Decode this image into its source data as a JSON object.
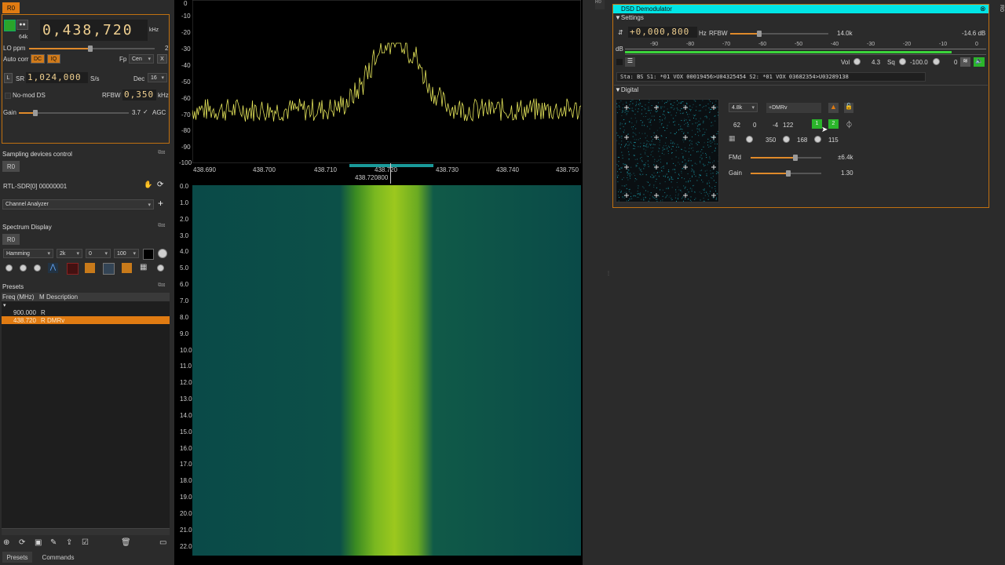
{
  "left": {
    "tab": "R0",
    "rate": "64k",
    "freq": "0,438,720",
    "freq_unit": "kHz",
    "lo_ppm_label": "LO ppm",
    "lo_ppm_value": "2",
    "auto_corr_label": "Auto corr",
    "dc": "DC",
    "iq": "IQ",
    "fp_label": "Fp",
    "fp_value": "Cen",
    "x": "X",
    "l": "L",
    "sr_label": "SR",
    "sr_value": "1,024,000",
    "sr_unit": "S/s",
    "dec_label": "Dec",
    "dec_value": "16",
    "nomod": "No-mod DS",
    "rfbw_label": "RFBW",
    "rfbw_value": "0,350",
    "rfbw_unit": "kHz",
    "gain_label": "Gain",
    "gain_value": "3.7",
    "agc": "AGC"
  },
  "sampling": {
    "title": "Sampling devices control",
    "tab": "R0",
    "device": "RTL-SDR[0] 00000001",
    "channel": "Channel Analyzer"
  },
  "spectrum_display": {
    "title": "Spectrum Display",
    "tab": "R0",
    "window": "Hamming",
    "fft": "2k",
    "ref": "0",
    "range": "100"
  },
  "presets": {
    "title": "Presets",
    "col_freq": "Freq (MHz)",
    "col_m": "M",
    "col_desc": "Description",
    "rows": [
      {
        "freq": "900.000",
        "m": "R",
        "desc": ""
      },
      {
        "freq": "438.720",
        "m": "R",
        "desc": "DMRv"
      }
    ],
    "tab_presets": "Presets",
    "tab_commands": "Commands"
  },
  "spectrum": {
    "db_ticks": [
      "0",
      "-10",
      "-20",
      "-30",
      "-40",
      "-50",
      "-60",
      "-70",
      "-80",
      "-90",
      "-100"
    ],
    "freq_ticks": [
      "438.690",
      "438.700",
      "438.710",
      "438.720",
      "438.730",
      "438.740",
      "438.750"
    ],
    "center": "438.720800"
  },
  "waterfall": {
    "time_ticks": [
      "0.0",
      "1.0",
      "2.0",
      "3.0",
      "4.0",
      "5.0",
      "6.0",
      "7.0",
      "8.0",
      "9.0",
      "10.0",
      "11.0",
      "12.0",
      "13.0",
      "14.0",
      "15.0",
      "16.0",
      "17.0",
      "18.0",
      "19.0",
      "20.0",
      "21.0",
      "22.0"
    ]
  },
  "dsd": {
    "title": "DSD Demodulator",
    "settings": "Settings",
    "shift": "+0,000,800",
    "shift_unit": "Hz",
    "rfbw_label": "RFBW",
    "rfbw_value": "14.0k",
    "level": "-14.6 dB",
    "db": "dB",
    "meter_ticks": [
      "-90",
      "-80",
      "-70",
      "-60",
      "-50",
      "-40",
      "-30",
      "-20",
      "-10",
      "0"
    ],
    "vol_label": "Vol",
    "vol_value": "4.3",
    "sq_label": "Sq",
    "sq_value": "-100.0",
    "sq_extra": "0",
    "status": "Sta: BS S1: *01 VOX 00019456>U04325454 S2: *01 VOX 03682354>U03289138",
    "digital": "Digital",
    "baud": "4.8k",
    "mode": "+DMRv",
    "n1": "62",
    "n2": "0",
    "n3": "-4",
    "n4": "122",
    "slot1": "1",
    "slot2": "2",
    "t1": "350",
    "t2": "168",
    "t3": "115",
    "fmd_label": "FMd",
    "fmd_value": "±6.4k",
    "gain_label": "Gain",
    "gain_value": "1.30"
  },
  "right_edge": {
    "tab": "R0"
  }
}
